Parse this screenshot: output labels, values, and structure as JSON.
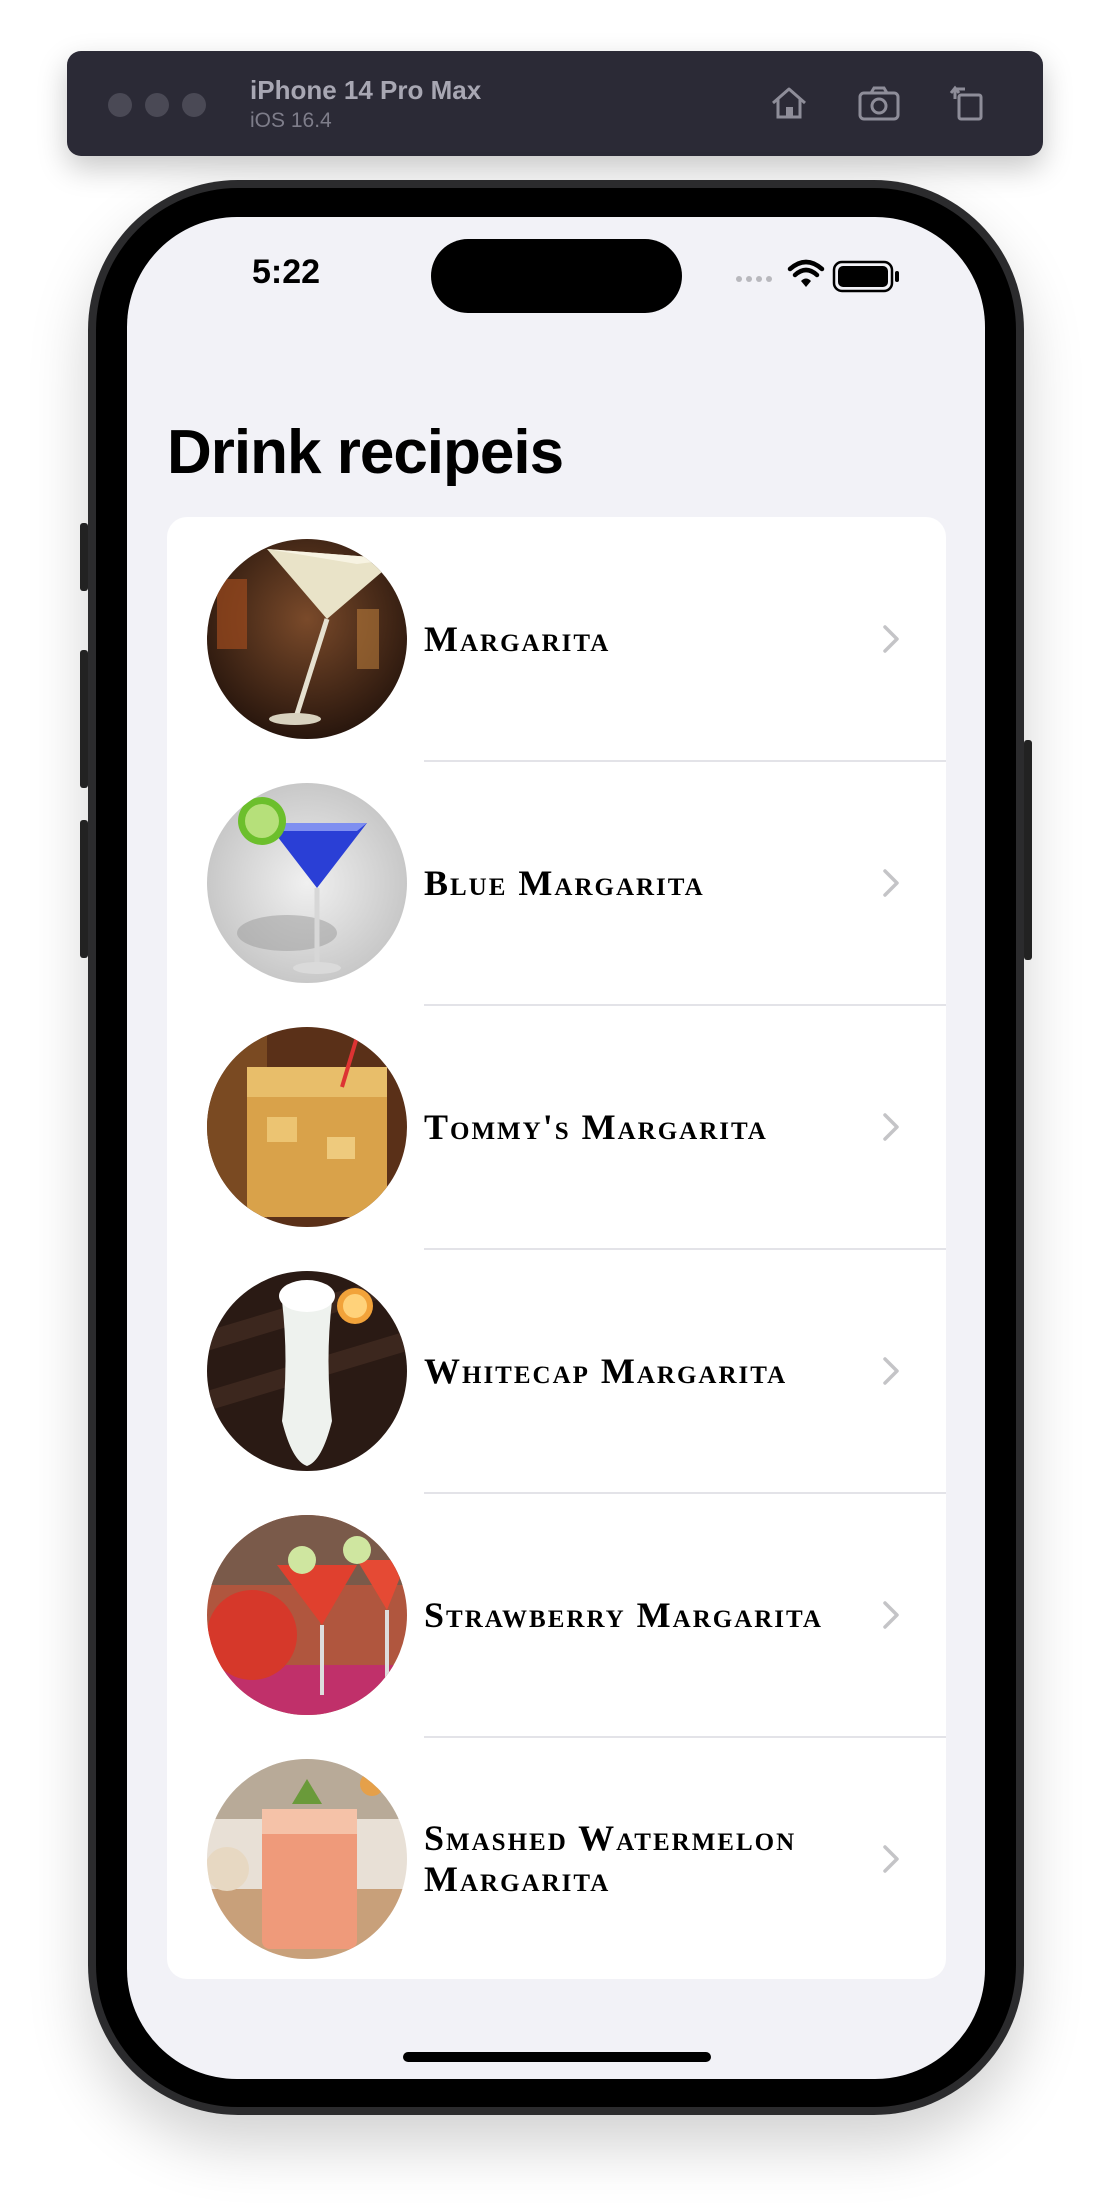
{
  "simulator": {
    "device_name": "iPhone 14 Pro Max",
    "os_version": "iOS 16.4",
    "icons": [
      "home-icon",
      "screenshot-icon",
      "rotate-icon"
    ]
  },
  "status_bar": {
    "time": "5:22",
    "icons": [
      "cellular-icon",
      "wifi-icon",
      "battery-icon"
    ]
  },
  "page_title": "Drink recipeis",
  "recipes": [
    {
      "name": "Margarita",
      "image": "margarita-photo"
    },
    {
      "name": "Blue Margarita",
      "image": "blue-margarita-photo"
    },
    {
      "name": "Tommy's Margarita",
      "image": "tommys-margarita-photo"
    },
    {
      "name": "Whitecap Margarita",
      "image": "whitecap-margarita-photo"
    },
    {
      "name": "Strawberry Margarita",
      "image": "strawberry-margarita-photo"
    },
    {
      "name": "Smashed Watermelon Margarita",
      "image": "smashed-watermelon-margarita-photo"
    }
  ],
  "colors": {
    "screen_background": "#f2f2f7",
    "list_background": "#ffffff",
    "chevron": "#c4c4c7",
    "toolbar": "#2b2a36"
  }
}
